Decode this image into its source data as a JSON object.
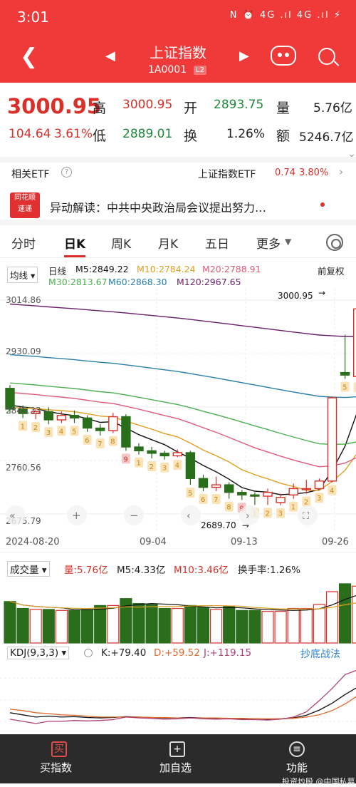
{
  "status": {
    "time": "3:01",
    "icons": "N ⏰ 4G .ıl 4G .ıl ⚡"
  },
  "header": {
    "title": "上证指数",
    "code": "1A0001",
    "badge": "L2"
  },
  "quote": {
    "price": "3000.95",
    "change": "104.64",
    "change_pct": "3.61%",
    "high_label": "高",
    "high": "3000.95",
    "low_label": "低",
    "low": "2889.01",
    "open_label": "开",
    "open": "2893.75",
    "turnover_label": "换",
    "turnover": "1.26%",
    "volume_label": "量",
    "volume": "5.76亿",
    "amount_label": "额",
    "amount": "5246.7亿"
  },
  "etf": {
    "label": "相关ETF",
    "name": "上证指数ETF",
    "price": "0.74",
    "pct": "3.80%"
  },
  "news": {
    "logo_top": "同花顺",
    "logo_bottom": "速递",
    "text": "异动解读：中共中央政治局会议提出努力…"
  },
  "tabs": [
    "分时",
    "日K",
    "周K",
    "月K",
    "五日",
    "更多"
  ],
  "ma": {
    "selector": "均线",
    "period": "日线",
    "adjust": "前复权",
    "m5": "M5:2849.22",
    "m10": "M10:2784.24",
    "m20": "M20:2788.91",
    "m30": "M30:2813.67",
    "m60": "M60:2868.30",
    "m120": "M120:2967.65"
  },
  "axis": {
    "y": [
      "3014.86",
      "2930.09",
      "2845.33",
      "2760.56",
      "2675.79"
    ],
    "x": [
      "2024-08-20",
      "09-04",
      "09-13",
      "09-26"
    ]
  },
  "annotations": {
    "high": "3000.95",
    "low": "2689.70"
  },
  "volume_panel": {
    "selector": "成交量",
    "vol": "量:5.76亿",
    "m5": "M5:4.33亿",
    "m10": "M10:3.46亿",
    "turnover": "换手率:1.26%"
  },
  "kdj_panel": {
    "name": "KDJ(9,3,3)",
    "k": "K:+79.40",
    "d": "D:+59.52",
    "j": "J:+119.15",
    "strategy": "抄底战法"
  },
  "bottom": {
    "buy": "买指数",
    "add": "加自选",
    "more": "功能",
    "watermark": "投资炒股 @中国私募日记"
  },
  "colors": {
    "up": "#d9302a",
    "down": "#2a6e1c",
    "m5": "#111111",
    "m10": "#e0a020",
    "m20": "#e05a7a",
    "m30": "#4caf50",
    "m60": "#2a7fa8",
    "m120": "#6a1e6a"
  },
  "chart_data": {
    "type": "candlestick",
    "ylim": [
      2675.79,
      3014.86
    ],
    "candles": [
      {
        "o": 2875,
        "c": 2842,
        "h": 2880,
        "l": 2835
      },
      {
        "o": 2842,
        "c": 2835,
        "h": 2848,
        "l": 2828
      },
      {
        "o": 2835,
        "c": 2838,
        "h": 2843,
        "l": 2826
      },
      {
        "o": 2838,
        "c": 2825,
        "h": 2845,
        "l": 2818
      },
      {
        "o": 2825,
        "c": 2832,
        "h": 2838,
        "l": 2820
      },
      {
        "o": 2832,
        "c": 2828,
        "h": 2840,
        "l": 2820
      },
      {
        "o": 2828,
        "c": 2812,
        "h": 2832,
        "l": 2806
      },
      {
        "o": 2812,
        "c": 2808,
        "h": 2818,
        "l": 2800
      },
      {
        "o": 2808,
        "c": 2830,
        "h": 2836,
        "l": 2804
      },
      {
        "o": 2830,
        "c": 2782,
        "h": 2834,
        "l": 2776
      },
      {
        "o": 2782,
        "c": 2776,
        "h": 2788,
        "l": 2770
      },
      {
        "o": 2776,
        "c": 2772,
        "h": 2782,
        "l": 2764
      },
      {
        "o": 2772,
        "c": 2768,
        "h": 2776,
        "l": 2762
      },
      {
        "o": 2768,
        "c": 2773,
        "h": 2778,
        "l": 2766
      },
      {
        "o": 2773,
        "c": 2732,
        "h": 2776,
        "l": 2722
      },
      {
        "o": 2732,
        "c": 2718,
        "h": 2738,
        "l": 2712
      },
      {
        "o": 2718,
        "c": 2722,
        "h": 2735,
        "l": 2712
      },
      {
        "o": 2722,
        "c": 2710,
        "h": 2726,
        "l": 2700
      },
      {
        "o": 2710,
        "c": 2706,
        "h": 2714,
        "l": 2698
      },
      {
        "o": 2706,
        "c": 2704,
        "h": 2710,
        "l": 2690
      },
      {
        "o": 2704,
        "c": 2710,
        "h": 2716,
        "l": 2690
      },
      {
        "o": 2694,
        "c": 2702,
        "h": 2708,
        "l": 2689.7
      },
      {
        "o": 2706,
        "c": 2716,
        "h": 2724,
        "l": 2700
      },
      {
        "o": 2716,
        "c": 2716,
        "h": 2730,
        "l": 2708
      },
      {
        "o": 2716,
        "c": 2728,
        "h": 2732,
        "l": 2714
      },
      {
        "o": 2728,
        "c": 2860,
        "h": 2862,
        "l": 2726
      },
      {
        "o": 2900,
        "c": 2896,
        "h": 2960,
        "l": 2890
      },
      {
        "o": 2893.75,
        "c": 3000.95,
        "h": 3000.95,
        "l": 2889.01
      }
    ],
    "volume": [
      4.2,
      3.5,
      3.4,
      3.4,
      3.3,
      3.3,
      3.4,
      3.8,
      3.8,
      4.5,
      4.0,
      3.9,
      3.5,
      3.5,
      3.8,
      3.6,
      3.4,
      3.7,
      3.3,
      3.3,
      3.2,
      3.2,
      3.5,
      3.5,
      3.9,
      5.2,
      6.0,
      5.76
    ],
    "kdj": {
      "k": [
        20,
        15,
        10,
        12,
        10,
        11,
        9,
        8,
        9,
        11,
        10,
        9,
        8,
        8,
        9,
        8,
        7,
        7,
        6,
        6,
        5,
        6,
        8,
        14,
        26,
        42,
        62,
        79.4
      ],
      "d": [
        28,
        25,
        20,
        18,
        15,
        14,
        12,
        10,
        10,
        10,
        10,
        9,
        9,
        8,
        8,
        8,
        8,
        7,
        7,
        6,
        6,
        6,
        7,
        10,
        15,
        25,
        40,
        59.52
      ],
      "j": [
        5,
        0,
        -5,
        0,
        0,
        2,
        1,
        2,
        4,
        10,
        8,
        7,
        5,
        6,
        8,
        6,
        5,
        6,
        4,
        4,
        3,
        5,
        10,
        22,
        48,
        76,
        108,
        119.15
      ]
    }
  }
}
